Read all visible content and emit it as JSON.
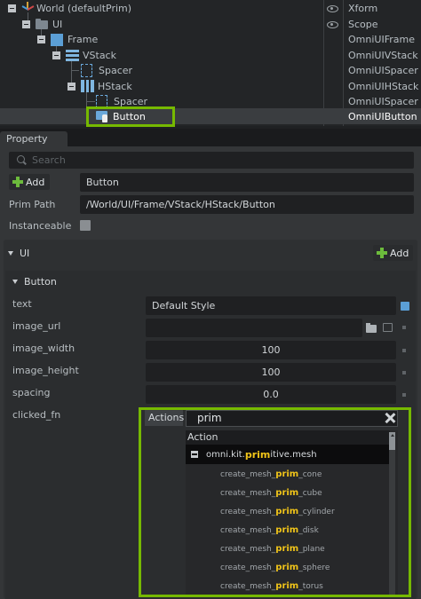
{
  "stage": {
    "rows": [
      {
        "name": "World (defaultPrim)",
        "type": "Xform",
        "visible": true
      },
      {
        "name": "UI",
        "type": "Scope",
        "visible": true
      },
      {
        "name": "Frame",
        "type": "OmniUIFrame"
      },
      {
        "name": "VStack",
        "type": "OmniUIVStack"
      },
      {
        "name": "Spacer",
        "type": "OmniUISpacer"
      },
      {
        "name": "HStack",
        "type": "OmniUIHStack"
      },
      {
        "name": "Spacer",
        "type": "OmniUISpacer"
      },
      {
        "name": "Button",
        "type": "OmniUIButton",
        "selected": true
      }
    ]
  },
  "property": {
    "tab_label": "Property",
    "search_placeholder": "Search",
    "add_label": "Add",
    "prim_name": "Button",
    "prim_path_label": "Prim Path",
    "prim_path": "/World/UI/Frame/VStack/HStack/Button",
    "instanceable_label": "Instanceable",
    "instanceable": false,
    "ui_section": {
      "title": "UI",
      "add_label": "Add"
    },
    "button_section": {
      "title": "Button",
      "fields": [
        {
          "label": "text",
          "value": "Default Style"
        },
        {
          "label": "image_url",
          "value": ""
        },
        {
          "label": "image_width",
          "value": "100"
        },
        {
          "label": "image_height",
          "value": "100"
        },
        {
          "label": "spacing",
          "value": "0.0"
        },
        {
          "label": "clicked_fn",
          "value": ""
        }
      ]
    }
  },
  "actions_popup": {
    "label": "Actions",
    "search_value": "prim",
    "header": "Action",
    "group": {
      "prefix": "omni.kit.",
      "match": "prim",
      "suffix": "itive.mesh"
    },
    "items": [
      {
        "prefix": "create_mesh_",
        "match": "prim",
        "suffix": "_cone"
      },
      {
        "prefix": "create_mesh_",
        "match": "prim",
        "suffix": "_cube"
      },
      {
        "prefix": "create_mesh_",
        "match": "prim",
        "suffix": "_cylinder"
      },
      {
        "prefix": "create_mesh_",
        "match": "prim",
        "suffix": "_disk"
      },
      {
        "prefix": "create_mesh_",
        "match": "prim",
        "suffix": "_plane"
      },
      {
        "prefix": "create_mesh_",
        "match": "prim",
        "suffix": "_sphere"
      },
      {
        "prefix": "create_mesh_",
        "match": "prim",
        "suffix": "_torus"
      }
    ]
  },
  "colors": {
    "highlight_frame": "#76b900",
    "match_text": "#f0c419",
    "ui_blue": "#5b9fd6"
  }
}
